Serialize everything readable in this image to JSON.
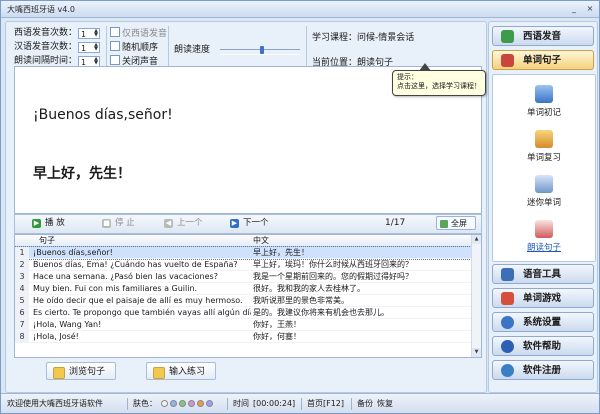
{
  "window": {
    "title": "大嘴西班牙语 v4.0",
    "controls": {
      "minimize": "_",
      "close": "×"
    }
  },
  "settings": {
    "es_play_count_label": "西语发音次数：",
    "es_play_count_value": "1",
    "cn_play_count_label": "汉语发音次数：",
    "cn_play_count_value": "1",
    "interval_label": "朗读间隔时间：",
    "interval_value": "1",
    "only_es_label": "仅西语发音",
    "random_order_label": "随机顺序",
    "mute_label": "关闭声音",
    "speed_label": "朗读速度",
    "course_label": "学习课程：问候-情景会话",
    "position_label": "当前位置：朗读句子",
    "tooltip_title": "提示：",
    "tooltip_text": "点击这里，选择学习课程！"
  },
  "display": {
    "spanish": "¡Buenos días,señor!",
    "chinese": "早上好，先生！"
  },
  "controls": {
    "play": "播 放",
    "stop": "停 止",
    "prev": "上一个",
    "next": "下一个",
    "counter": "1/17",
    "fullscreen": "全屏"
  },
  "table": {
    "headers": {
      "es": "句子",
      "zh": "中文"
    },
    "rows": [
      {
        "num": "1",
        "es": "¡Buenos días,señor!",
        "zh": "早上好，先生！"
      },
      {
        "num": "2",
        "es": "Buenos días, Ema! ¿Cuándo has vuelto de España?",
        "zh": "早上好，埃玛！你什么时候从西班牙回来的？"
      },
      {
        "num": "3",
        "es": "Hace una semana. ¿Pasó bien las vacaciones?",
        "zh": "我是一个星期前回来的。您的假期过得好吗？"
      },
      {
        "num": "4",
        "es": "Muy bien. Fui con mis familiares a Guilin.",
        "zh": "很好。我和我的家人去桂林了。"
      },
      {
        "num": "5",
        "es": "He oído decir que el paisaje de allí es muy hermoso.",
        "zh": "我听说那里的景色非常美。"
      },
      {
        "num": "6",
        "es": "Es cierto. Te propongo que también vayas allí algún día.",
        "zh": "是的。我建议你将来有机会也去那儿。"
      },
      {
        "num": "7",
        "es": "¡Hola, Wang Yan!",
        "zh": "你好，王燕！"
      },
      {
        "num": "8",
        "es": "¡Hola, José!",
        "zh": "你好，何塞！"
      }
    ]
  },
  "bottom_buttons": {
    "browse": "浏览句子",
    "input": "输入练习"
  },
  "sidebar": {
    "es_pronunciation": "西语发音",
    "word_sentence": "单词句子",
    "sub_items": [
      "单词初记",
      "单词复习",
      "迷你单词",
      "朗读句子"
    ],
    "voice_tools": "语音工具",
    "word_games": "单词游戏",
    "system_settings": "系统设置",
    "help": "软件帮助",
    "register": "软件注册"
  },
  "status": {
    "welcome": "欢迎使用大嘴西班牙语软件",
    "skin_label": "肤色：",
    "skin_colors": [
      "#f0f0f0",
      "#8fb3e8",
      "#7fc97f",
      "#d58fd5",
      "#e89a4a",
      "#9aa0ff"
    ],
    "time_label": "时间",
    "time_value": "[00:00:24]",
    "home": "首页[F12]",
    "backup": "备份",
    "restore": "恢复"
  },
  "colors": {
    "accent": "#3c72c8",
    "selected_row": "#cfe1fb",
    "tooltip_bg": "#ffffe1"
  }
}
